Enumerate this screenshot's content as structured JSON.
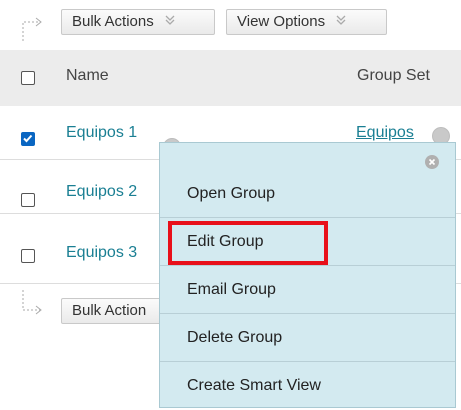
{
  "toolbar_top": {
    "bulk_actions": "Bulk Actions",
    "view_options": "View Options"
  },
  "toolbar_bottom": {
    "bulk_actions": "Bulk Action"
  },
  "table": {
    "columns": [
      "Name",
      "Group Set"
    ],
    "rows": [
      {
        "name": "Equipos 1",
        "group_set": "Equipos",
        "checked": true
      },
      {
        "name": "Equipos 2",
        "group_set": "",
        "checked": false
      },
      {
        "name": "Equipos 3",
        "group_set": "",
        "checked": false
      }
    ]
  },
  "context_menu": {
    "items": [
      "Open Group",
      "Edit Group",
      "Email Group",
      "Delete Group",
      "Create Smart View"
    ],
    "highlighted_item": "Edit Group"
  },
  "colors": {
    "link": "#1a7f93",
    "menu_bg": "#d3eaf0",
    "highlight": "#e8101a",
    "checkbox": "#0a66c2"
  }
}
